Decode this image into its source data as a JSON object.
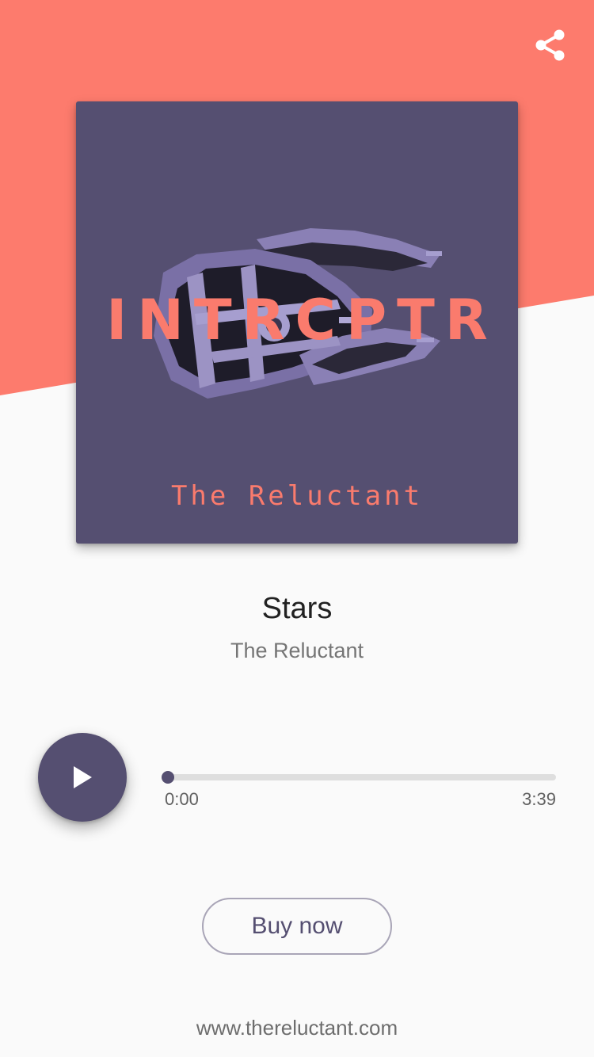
{
  "colors": {
    "accent": "#fa7b6d",
    "primary": "#554f71",
    "background": "#fafafa",
    "header_bg": "#fd7b6d"
  },
  "header": {
    "share_icon": "share-icon"
  },
  "album": {
    "title": "INTRCPTR",
    "artist": "The Reluctant",
    "art_subject": "spaceship"
  },
  "track": {
    "title": "Stars",
    "artist": "The Reluctant"
  },
  "player": {
    "play_icon": "play-icon",
    "elapsed": "0:00",
    "duration": "3:39",
    "progress_fraction": 0
  },
  "actions": {
    "buy_label": "Buy now"
  },
  "footer": {
    "website": "www.thereluctant.com"
  }
}
